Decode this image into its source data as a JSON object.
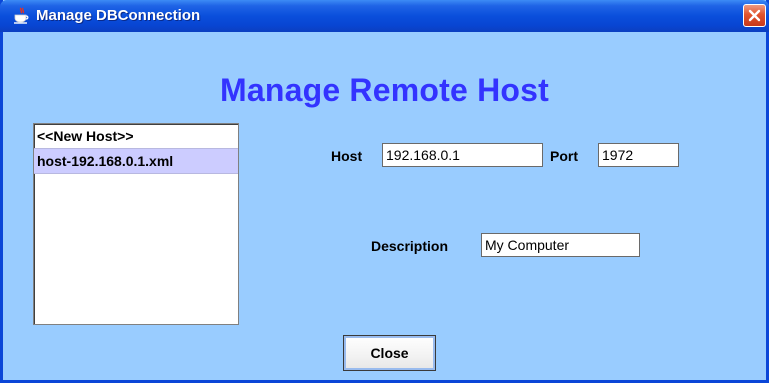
{
  "window": {
    "title": "Manage DBConnection",
    "icon": "java-cup-icon",
    "accent_color": "#0a46d8",
    "background_color": "#99ccff"
  },
  "heading": "Manage Remote Host",
  "host_list": {
    "items": [
      {
        "label": "<<New Host>>",
        "selected": false
      },
      {
        "label": "host-192.168.0.1.xml",
        "selected": true
      }
    ]
  },
  "form": {
    "host_label": "Host",
    "host_value": "192.168.0.1",
    "port_label": "Port",
    "port_value": "1972",
    "description_label": "Description",
    "description_value": "My Computer"
  },
  "buttons": {
    "close_label": "Close"
  }
}
